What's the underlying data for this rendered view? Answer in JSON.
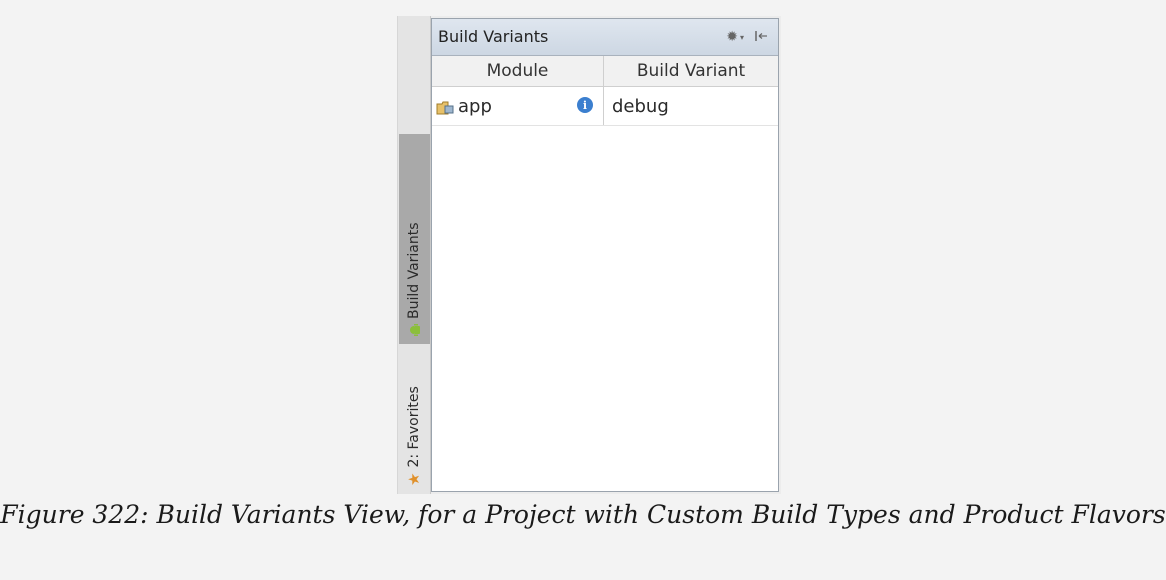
{
  "panel": {
    "title": "Build Variants",
    "columns": [
      "Module",
      "Build Variant"
    ],
    "rows": [
      {
        "module": "app",
        "variant": "debug"
      }
    ]
  },
  "side_tabs": [
    {
      "label": "Build Variants",
      "active": true,
      "icon": "android-icon"
    },
    {
      "label": "2: Favorites",
      "active": false,
      "icon": "star-icon"
    }
  ],
  "caption": "Figure 322: Build Variants View, for a Project with Custom Build Types and Product Flavors",
  "colors": {
    "header_gradient_top": "#dfe6ef",
    "active_tab": "#a9a9a9",
    "info_icon": "#3b7fcf",
    "star": "#e0902a",
    "android": "#8bbf3b"
  }
}
